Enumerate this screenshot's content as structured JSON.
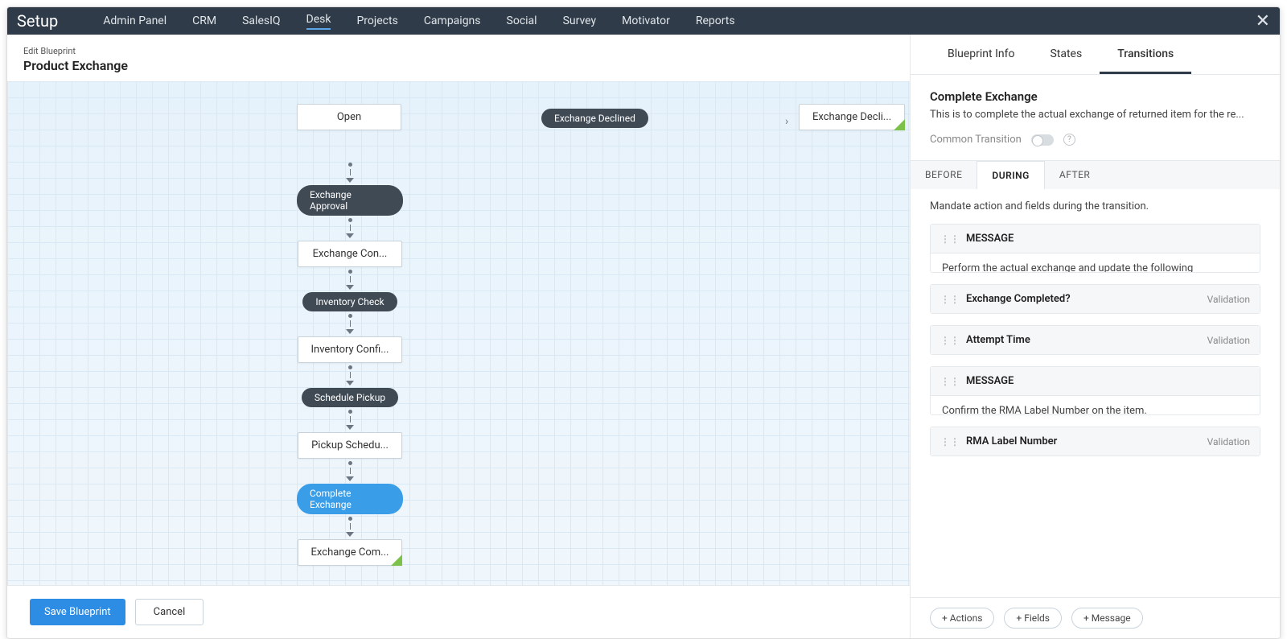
{
  "topnav": {
    "brand": "Setup",
    "items": [
      "Admin Panel",
      "CRM",
      "SalesIQ",
      "Desk",
      "Projects",
      "Campaigns",
      "Social",
      "Survey",
      "Motivator",
      "Reports"
    ],
    "active_index": 3
  },
  "canvas": {
    "crumb": "Edit Blueprint",
    "title": "Product Exchange",
    "top_row": {
      "state": "Open",
      "transition": "Exchange Declined",
      "terminal": "Exchange Decli..."
    },
    "column": [
      {
        "type": "transition",
        "label": "Exchange Approval"
      },
      {
        "type": "state",
        "label": "Exchange Con..."
      },
      {
        "type": "transition",
        "label": "Inventory Check"
      },
      {
        "type": "state",
        "label": "Inventory Confi..."
      },
      {
        "type": "transition",
        "label": "Schedule Pickup"
      },
      {
        "type": "state",
        "label": "Pickup Schedu..."
      },
      {
        "type": "transition",
        "label": "Complete Exchange",
        "selected": true
      },
      {
        "type": "state",
        "label": "Exchange Com...",
        "terminal": true
      }
    ]
  },
  "footer_left": {
    "save": "Save Blueprint",
    "cancel": "Cancel"
  },
  "sidepanel": {
    "tabs": [
      "Blueprint Info",
      "States",
      "Transitions"
    ],
    "active_tab_index": 2,
    "detail": {
      "title": "Complete Exchange",
      "description": "This is to complete the actual exchange of returned item for the re...",
      "common_label": "Common Transition",
      "common_enabled": false
    },
    "phase_tabs": [
      "BEFORE",
      "DURING",
      "AFTER"
    ],
    "phase_active_index": 1,
    "mandate_text": "Mandate action and fields during the transition.",
    "items": [
      {
        "header": "MESSAGE",
        "body": "Perform the actual exchange and update the following"
      },
      {
        "header": "Exchange Completed?",
        "tag": "Validation"
      },
      {
        "header": "Attempt Time",
        "tag": "Validation"
      },
      {
        "header": "MESSAGE",
        "body": "Confirm the RMA Label Number on the item."
      },
      {
        "header": "RMA Label Number",
        "tag": "Validation"
      }
    ],
    "footer_buttons": [
      "+ Actions",
      "+ Fields",
      "+ Message"
    ]
  }
}
